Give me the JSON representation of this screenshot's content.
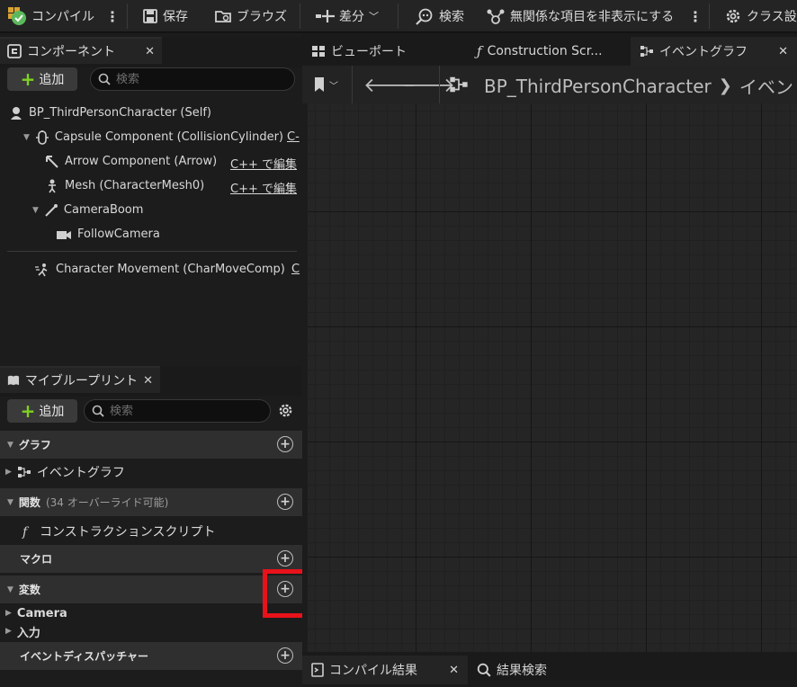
{
  "toolbar": {
    "compile": "コンパイル",
    "save": "保存",
    "browse": "ブラウズ",
    "diff": "差分",
    "find": "検索",
    "hide_unrelated": "無関係な項目を非表示にする",
    "class_settings": "クラス設"
  },
  "components_panel": {
    "tab_label": "コンポーネント",
    "add_label": "追加",
    "search_placeholder": "検索",
    "self_label": "BP_ThirdPersonCharacter (Self)",
    "items": [
      {
        "label": "Capsule Component (CollisionCylinder)",
        "edit": "C-"
      },
      {
        "label": "Arrow Component (Arrow)",
        "edit": "C++ で編集"
      },
      {
        "label": "Mesh (CharacterMesh0)",
        "edit": "C++ で編集"
      },
      {
        "label": "CameraBoom",
        "edit": ""
      },
      {
        "label": "FollowCamera",
        "edit": ""
      },
      {
        "label": "Character Movement (CharMoveComp)",
        "edit": "C"
      }
    ]
  },
  "my_blueprint": {
    "tab_label": "マイブループリント",
    "add_label": "追加",
    "search_placeholder": "検索",
    "categories": {
      "graphs": "グラフ",
      "functions": "関数",
      "functions_sub": "(34 オーバーライド可能)",
      "macros": "マクロ",
      "variables": "変数",
      "dispatchers": "イベントディスパッチャー"
    },
    "event_graph_item": "イベントグラフ",
    "construction_script_item": "コンストラクションスクリプト",
    "variable_groups": [
      "Camera",
      "入力"
    ]
  },
  "graph_tabs": {
    "viewport": "ビューポート",
    "construction": "Construction Scr...",
    "event_graph": "イベントグラフ"
  },
  "graph_toolbar": {
    "breadcrumb_root": "BP_ThirdPersonCharacter",
    "breadcrumb_current": "イベント"
  },
  "bottom_tabs": {
    "compile_results": "コンパイル結果",
    "find_results": "結果検索"
  },
  "colors": {
    "add_plus": "#7ed321",
    "highlight_box": "#e8121a",
    "compile_ok": "#5cb85c"
  }
}
